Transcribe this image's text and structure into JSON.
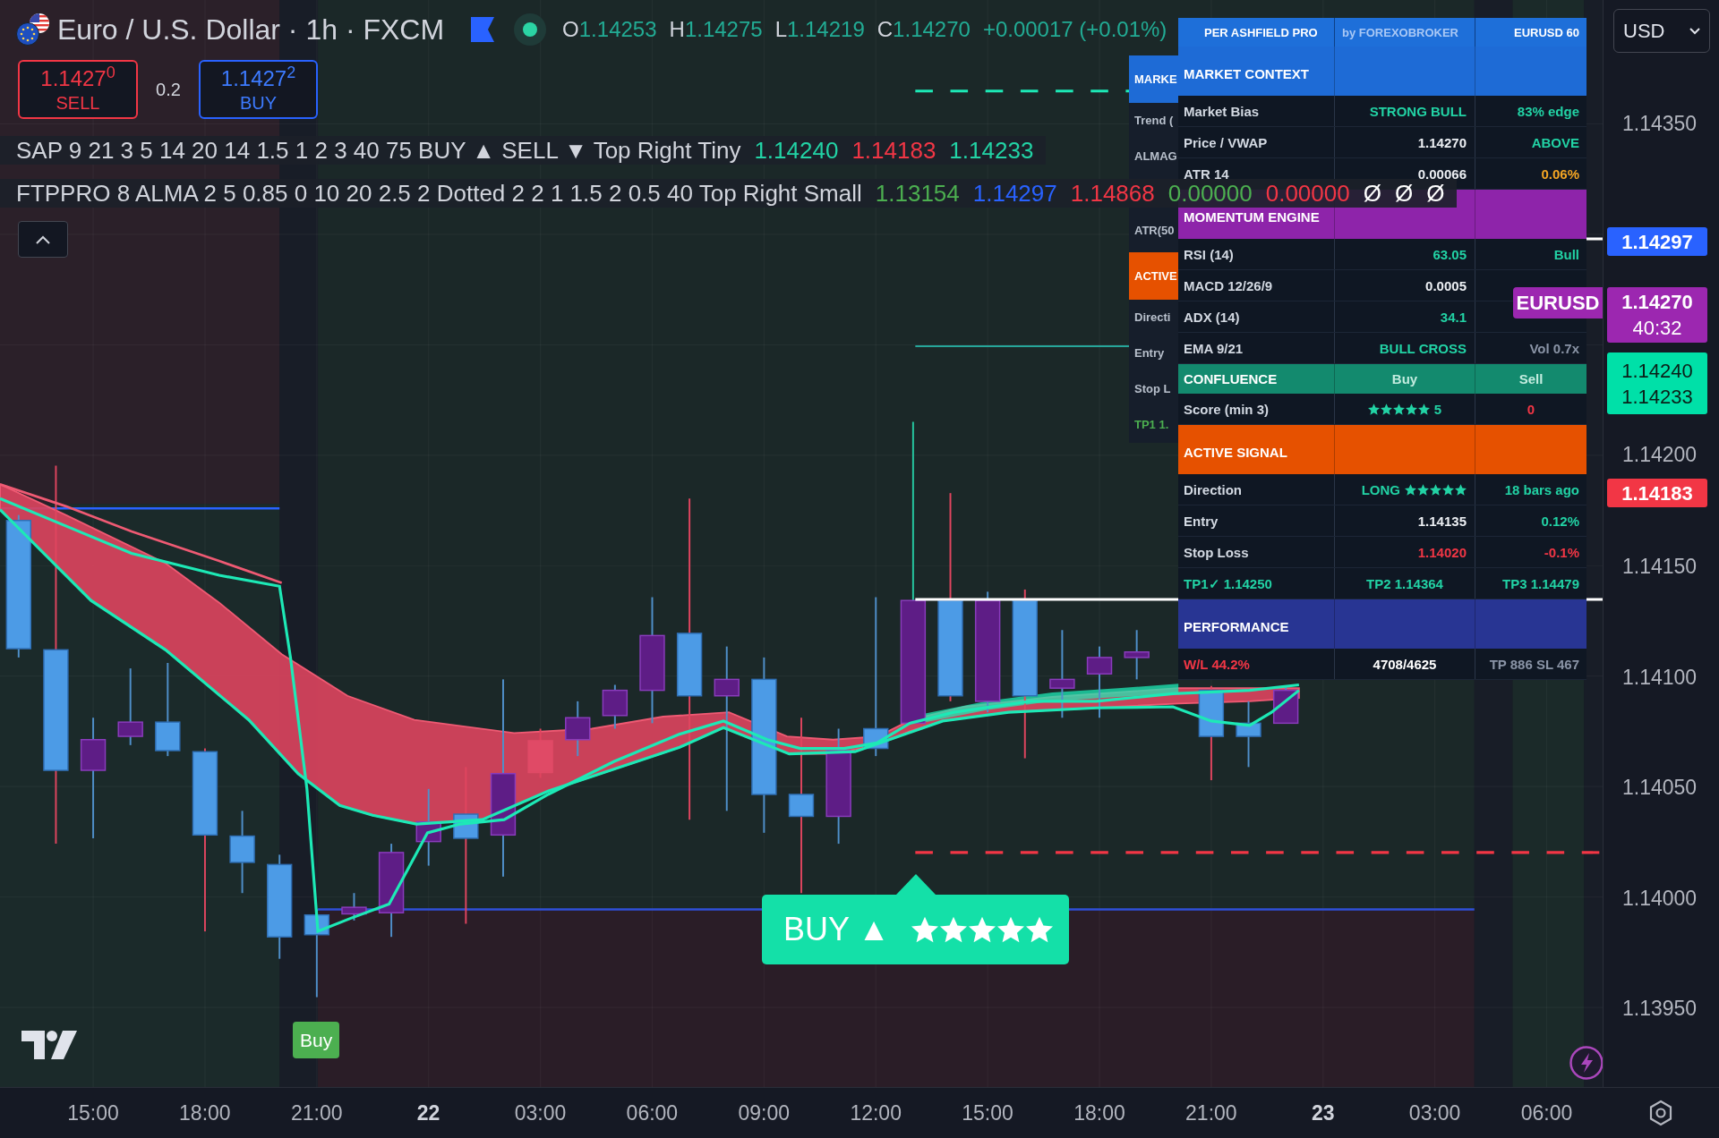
{
  "legend": {
    "title": "Euro / U.S. Dollar · 1h · FXCM",
    "market_open": true,
    "ohlc": [
      {
        "label": "O",
        "value": "1.14253"
      },
      {
        "label": "H",
        "value": "1.14275"
      },
      {
        "label": "L",
        "value": "1.14219"
      },
      {
        "label": "C",
        "value": "1.14270"
      }
    ],
    "change": "+0.00017 (+0.01%)",
    "sell": {
      "price": "1.1427$^{0}$",
      "label": "SELL"
    },
    "spread": "0.2",
    "buy": {
      "price": "1.1427$^{2}$",
      "label": "BUY"
    },
    "indicators": [
      {
        "name": "SAP 9 21 3 5 14 20 14 1.5 1 2 3 40 75 BUY ▲ SELL ▼ Top Right Tiny",
        "values": [
          {
            "text": "1.14240",
            "color": "#22d3a5"
          },
          {
            "text": "1.14183",
            "color": "#f23645"
          },
          {
            "text": "1.14233",
            "color": "#22d3a5"
          }
        ]
      },
      {
        "name": "FTPPRO 8 ALMA 2 5 0.85 0 10 20 2.5 2 Dotted 2 2 1 1.5 2 0.5 40 Top Right Small",
        "values": [
          {
            "text": "1.13154",
            "color": "#4caf50"
          },
          {
            "text": "1.14297",
            "color": "#2962ff"
          },
          {
            "text": "1.14868",
            "color": "#f23645"
          },
          {
            "text": "0.00000",
            "color": "#4caf50"
          },
          {
            "text": "0.00000",
            "color": "#f23645"
          },
          {
            "text": "Ø",
            "color": "#ffffff"
          },
          {
            "text": "Ø",
            "color": "#ffffff"
          },
          {
            "text": "Ø",
            "color": "#ffffff"
          }
        ]
      }
    ],
    "expanded": true
  },
  "background_table": {
    "rows": [
      {
        "kind": "section",
        "text": "MARKE",
        "color": "#1e6bd6"
      },
      {
        "kind": "row",
        "text": "Trend ("
      },
      {
        "kind": "row",
        "text": "ALMAG"
      },
      {
        "kind": "row",
        "text": "ATR(50"
      },
      {
        "kind": "section",
        "text": "ACTIVE",
        "color": "#e65100"
      },
      {
        "kind": "row",
        "text": "Directi"
      },
      {
        "kind": "row",
        "text": "Entry"
      },
      {
        "kind": "row",
        "text": "Stop L"
      },
      {
        "kind": "row",
        "text": "TP1 1.",
        "color": "#4caf50"
      }
    ]
  },
  "signal_table": {
    "header": [
      "PER ASHFIELD PRO",
      "by FOREXOBROKER",
      "EURUSD 60"
    ],
    "rows": [
      {
        "kind": "section",
        "title": "MARKET CONTEXT",
        "color": "#1e6bd6"
      },
      {
        "kind": "metric",
        "label": {
          "text": "Market Bias"
        },
        "value": {
          "text": "STRONG BULL",
          "color": "#22d3a5"
        },
        "note": {
          "text": "83% edge",
          "color": "#22d3a5"
        }
      },
      {
        "kind": "metric",
        "label": {
          "text": "Price / VWAP"
        },
        "value": {
          "text": "1.14270",
          "color": "#eceff3"
        },
        "note": {
          "text": "ABOVE",
          "color": "#22d3a5"
        }
      },
      {
        "kind": "metric",
        "label": {
          "text": "ATR 14"
        },
        "value": {
          "text": "0.00066",
          "color": "#eceff3"
        },
        "note": {
          "text": "0.06%",
          "color": "#f5a623"
        }
      },
      {
        "kind": "section",
        "title": "MOMENTUM ENGINE",
        "color": "#8e24aa"
      },
      {
        "kind": "metric",
        "label": {
          "text": "RSI (14)"
        },
        "value": {
          "text": "63.05",
          "color": "#22d3a5"
        },
        "note": {
          "text": "Bull",
          "color": "#22d3a5"
        }
      },
      {
        "kind": "metric",
        "label": {
          "text": "MACD 12/26/9"
        },
        "value": {
          "text": "0.0005",
          "color": "#eceff3"
        }
      },
      {
        "kind": "metric",
        "label": {
          "text": "ADX (14)"
        },
        "value": {
          "text": "34.1",
          "color": "#22d3a5"
        }
      },
      {
        "kind": "metric",
        "label": {
          "text": "EMA 9/21"
        },
        "value": {
          "text": "BULL CROSS",
          "color": "#22d3a5"
        },
        "note": {
          "text": "Vol 0.7x",
          "color": "#8a94a6"
        }
      },
      {
        "kind": "section",
        "title": "CONFLUENCE",
        "color": "#138a6e",
        "columns": [
          "Buy",
          "Sell"
        ]
      },
      {
        "kind": "score",
        "label": {
          "text": "Score (min 3)"
        },
        "value": {
          "text": "5",
          "color": "#22d3a5",
          "stars": 5
        },
        "note": {
          "text": "0",
          "color": "#f23645"
        }
      },
      {
        "kind": "section",
        "title": "ACTIVE SIGNAL",
        "color": "#e65100"
      },
      {
        "kind": "metric",
        "label": {
          "text": "Direction"
        },
        "value": {
          "text": "LONG",
          "color": "#22d3a5",
          "stars": 5
        },
        "note": {
          "text": "18 bars ago",
          "color": "#22d3a5"
        }
      },
      {
        "kind": "metric",
        "label": {
          "text": "Entry"
        },
        "value": {
          "text": "1.14135",
          "color": "#eceff3"
        },
        "note": {
          "text": "0.12%",
          "color": "#22d3a5"
        }
      },
      {
        "kind": "metric",
        "label": {
          "text": "Stop Loss"
        },
        "value": {
          "text": "1.14020",
          "color": "#f23645"
        },
        "note": {
          "text": "-0.1%",
          "color": "#f23645"
        }
      },
      {
        "kind": "targets",
        "label": {
          "text": "TP1✓ 1.14250",
          "color": "#22d3a5"
        },
        "value": {
          "text": "TP2 1.14364",
          "color": "#22d3a5"
        },
        "note": {
          "text": "TP3 1.14479",
          "color": "#22d3a5"
        }
      },
      {
        "kind": "section",
        "title": "PERFORMANCE",
        "color": "#283593"
      },
      {
        "kind": "stats",
        "label": {
          "text": "W/L 44.2%",
          "color": "#f23645"
        },
        "value": {
          "text": "4708/4625",
          "color": "#ffffff"
        },
        "note": {
          "text": "TP 886 SL 467",
          "color": "#8a94a6"
        }
      }
    ]
  },
  "chart_signals": [
    {
      "kind": "marker",
      "text": "Buy"
    },
    {
      "kind": "label",
      "text": "BUY ▲",
      "stars": 5
    }
  ],
  "price_axis": {
    "currency": "USD",
    "ticks": [
      "1.14350",
      "1.14200",
      "1.14150",
      "1.14100",
      "1.14050",
      "1.14000",
      "1.13950"
    ],
    "labels": [
      {
        "lines": [
          "1.14297"
        ],
        "color": "#2962ff"
      },
      {
        "tag": "EURUSD",
        "lines": [
          "1.14270",
          "40:32"
        ],
        "color": "#9c27b0"
      },
      {
        "lines": [
          "1.14240",
          "1.14233"
        ],
        "color": "#00e0a8"
      },
      {
        "lines": [
          "1.14183"
        ],
        "color": "#f23645"
      }
    ]
  },
  "time_axis": {
    "ticks": [
      {
        "kind": "time",
        "text": "15:00"
      },
      {
        "kind": "time",
        "text": "18:00"
      },
      {
        "kind": "time",
        "text": "21:00"
      },
      {
        "kind": "day",
        "text": "22"
      },
      {
        "kind": "time",
        "text": "03:00"
      },
      {
        "kind": "time",
        "text": "06:00"
      },
      {
        "kind": "time",
        "text": "09:00"
      },
      {
        "kind": "time",
        "text": "12:00"
      },
      {
        "kind": "time",
        "text": "15:00"
      },
      {
        "kind": "time",
        "text": "18:00"
      },
      {
        "kind": "time",
        "text": "21:00"
      },
      {
        "kind": "day",
        "text": "23"
      },
      {
        "kind": "time",
        "text": "03:00"
      },
      {
        "kind": "time",
        "text": "06:00"
      }
    ]
  }
}
